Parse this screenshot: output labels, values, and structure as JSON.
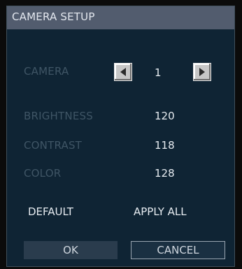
{
  "dialog": {
    "title": "CAMERA SETUP"
  },
  "camera": {
    "label": "CAMERA",
    "value": "1",
    "prev_icon": "left-arrow-icon",
    "next_icon": "right-arrow-icon"
  },
  "settings": [
    {
      "label": "BRIGHTNESS",
      "value": "120"
    },
    {
      "label": "CONTRAST",
      "value": "118"
    },
    {
      "label": "COLOR",
      "value": "128"
    }
  ],
  "actions": {
    "default_label": "DEFAULT",
    "apply_all_label": "APPLY ALL"
  },
  "buttons": {
    "ok_label": "OK",
    "cancel_label": "CANCEL"
  },
  "colors": {
    "dialog_bg": "#0f2434",
    "titlebar_bg": "#525c6e",
    "dim_label": "#3f5565",
    "value_text": "#e6ebf0"
  }
}
